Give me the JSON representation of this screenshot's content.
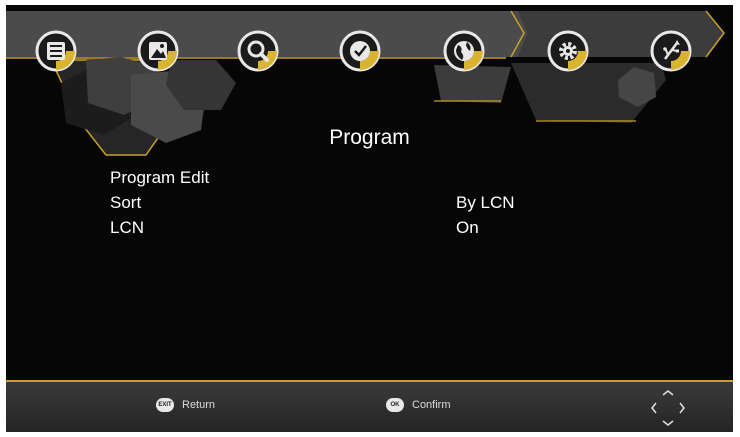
{
  "menu": {
    "tabs": [
      {
        "icon": "program-list-icon",
        "active": false
      },
      {
        "icon": "picture-icon",
        "active": false
      },
      {
        "icon": "search-icon",
        "active": false
      },
      {
        "icon": "clock-icon",
        "active": false
      },
      {
        "icon": "globe-icon",
        "active": false
      },
      {
        "icon": "gear-icon",
        "active": true
      },
      {
        "icon": "usb-icon",
        "active": false
      }
    ]
  },
  "page": {
    "title": "Program",
    "items": [
      {
        "label": "Program Edit",
        "value": ""
      },
      {
        "label": "Sort",
        "value": "By LCN"
      },
      {
        "label": "LCN",
        "value": "On"
      }
    ]
  },
  "footer": {
    "return_key": "EXIT",
    "return_label": "Return",
    "confirm_key": "OK",
    "confirm_label": "Confirm"
  },
  "colors": {
    "accent": "#d9b431",
    "background": "#060606",
    "panel": "#3a3a3a"
  }
}
